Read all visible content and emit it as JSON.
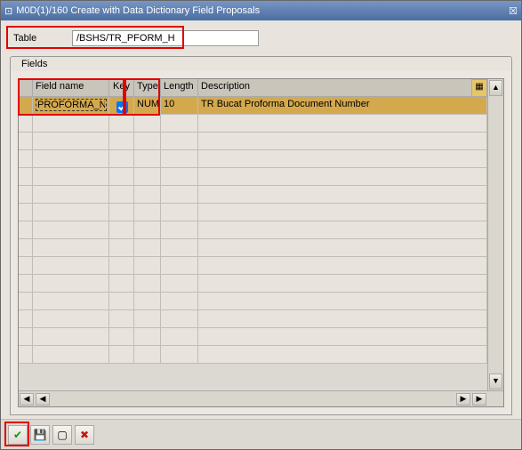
{
  "window": {
    "title": "M0D(1)/160 Create with Data Dictionary Field Proposals"
  },
  "form": {
    "table_label": "Table",
    "table_value": "/BSHS/TR_PFORM_H"
  },
  "tabs": {
    "fields": "Fields"
  },
  "grid": {
    "headers": {
      "field_name": "Field name",
      "key": "Key",
      "type": "Type",
      "length": "Length",
      "description": "Description"
    },
    "rows": [
      {
        "field_name": "PROFORMA_NR",
        "key": true,
        "type": "NUMC",
        "length": "10",
        "description": "TR Bucat Proforma Document Number"
      }
    ]
  },
  "icons": {
    "check": "✔",
    "x": "✖",
    "config": "▦",
    "up": "▲",
    "down": "▼",
    "left": "◀",
    "right": "▶"
  }
}
